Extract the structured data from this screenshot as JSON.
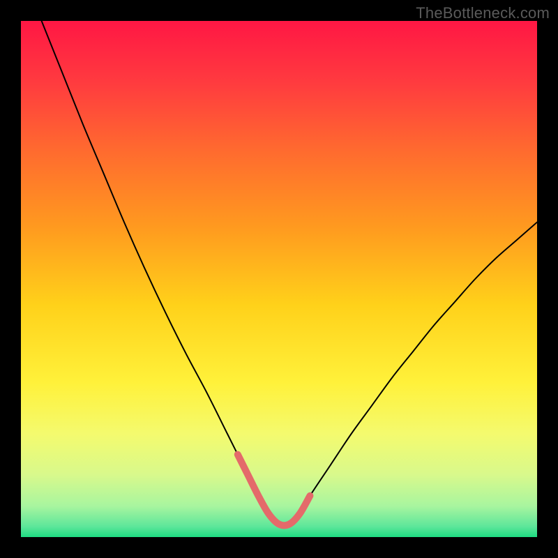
{
  "watermark": "TheBottleneck.com",
  "chart_data": {
    "type": "line",
    "title": "",
    "xlabel": "",
    "ylabel": "",
    "xlim": [
      0,
      100
    ],
    "ylim": [
      0,
      100
    ],
    "background_gradient": {
      "stops": [
        {
          "offset": 0.0,
          "color": "#ff1744"
        },
        {
          "offset": 0.12,
          "color": "#ff3b3f"
        },
        {
          "offset": 0.25,
          "color": "#ff6a2f"
        },
        {
          "offset": 0.4,
          "color": "#ff9a1f"
        },
        {
          "offset": 0.55,
          "color": "#ffd11a"
        },
        {
          "offset": 0.7,
          "color": "#fff13a"
        },
        {
          "offset": 0.8,
          "color": "#f4fa6e"
        },
        {
          "offset": 0.88,
          "color": "#d8f98c"
        },
        {
          "offset": 0.94,
          "color": "#a8f59f"
        },
        {
          "offset": 0.98,
          "color": "#5ce69a"
        },
        {
          "offset": 1.0,
          "color": "#1edc82"
        }
      ]
    },
    "series": [
      {
        "name": "bottleneck-curve",
        "color": "#000000",
        "width": 2,
        "x": [
          4,
          8,
          12,
          16,
          20,
          24,
          28,
          32,
          36,
          40,
          42,
          44,
          46,
          48,
          50,
          52,
          54,
          56,
          60,
          64,
          68,
          72,
          76,
          80,
          84,
          88,
          92,
          96,
          100
        ],
        "values": [
          100,
          90,
          80,
          70.5,
          61,
          52,
          43.5,
          35.5,
          28,
          20,
          16,
          12,
          8,
          4.5,
          2.5,
          2.5,
          4.5,
          8,
          14,
          20,
          25.5,
          31,
          36,
          41,
          45.5,
          50,
          54,
          57.5,
          61
        ]
      },
      {
        "name": "optimal-range-marker",
        "color": "#e46a6a",
        "width": 10,
        "x": [
          42,
          44,
          46,
          48,
          50,
          52,
          54,
          56
        ],
        "values": [
          16,
          12,
          8,
          4.5,
          2.5,
          2.5,
          4.5,
          8
        ]
      }
    ]
  }
}
